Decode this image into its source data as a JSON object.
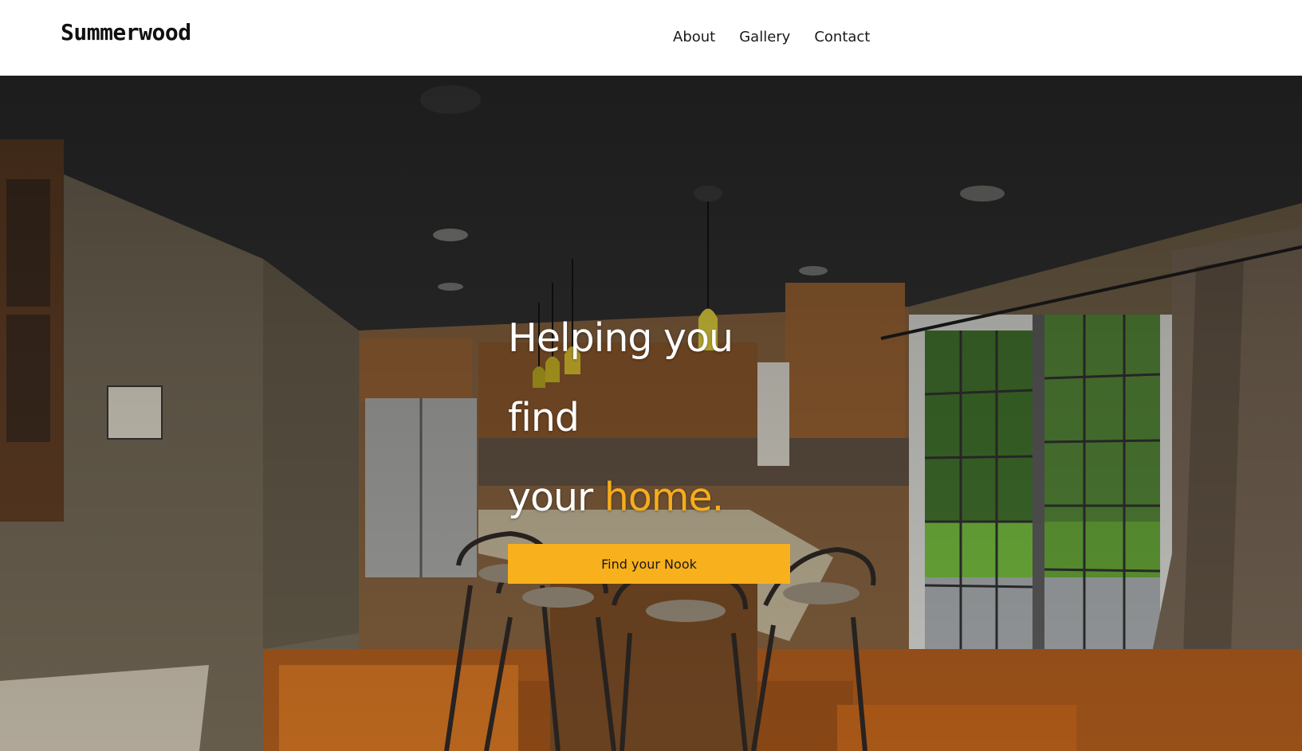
{
  "brand": {
    "name": "Summerwood"
  },
  "nav": {
    "items": [
      {
        "label": "About"
      },
      {
        "label": "Gallery"
      },
      {
        "label": "Contact"
      }
    ]
  },
  "hero": {
    "headline_part1": "Helping you find",
    "headline_part2": "your",
    "headline_accent": "home.",
    "cta_label": "Find your Nook",
    "background": "kitchen-interior-photo"
  },
  "colors": {
    "accent": "#f8b01c",
    "header_bg": "#ffffff",
    "text_dark": "#1a1a1a",
    "headline_text": "#ffffff"
  }
}
